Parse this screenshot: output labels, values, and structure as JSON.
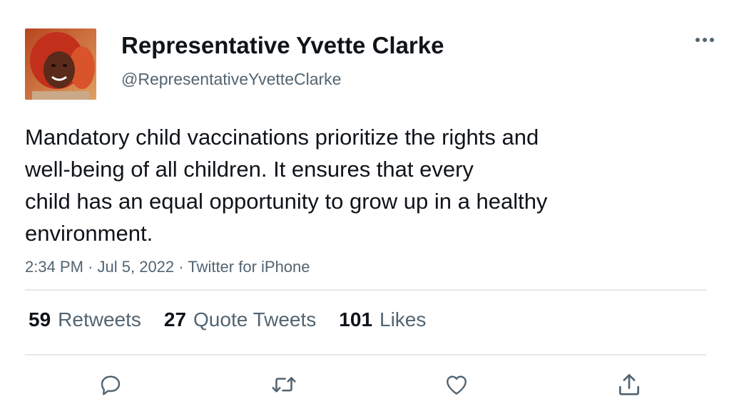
{
  "author": {
    "display_name": "Representative Yvette Clarke",
    "handle": "@RepresentativeYvetteClarke",
    "avatar_icon": "profile-photo"
  },
  "tweet": {
    "text_lines": [
      "Mandatory child vaccinations prioritize the rights and",
      "well-being of all children. It ensures that every",
      "child has an equal opportunity to grow up in a healthy",
      "environment."
    ],
    "time": "2:34 PM",
    "date": "Jul 5, 2022",
    "source": "Twitter for iPhone",
    "separator": "·"
  },
  "stats": {
    "retweets": {
      "count": "59",
      "label": "Retweets"
    },
    "quote_tweets": {
      "count": "27",
      "label": "Quote Tweets"
    },
    "likes": {
      "count": "101",
      "label": "Likes"
    }
  },
  "actions": [
    "reply-icon",
    "retweet-icon",
    "like-icon",
    "share-icon"
  ],
  "colors": {
    "text_primary": "#0f1419",
    "text_secondary": "#536471",
    "divider": "#e6e8ea",
    "icon": "#536471"
  }
}
